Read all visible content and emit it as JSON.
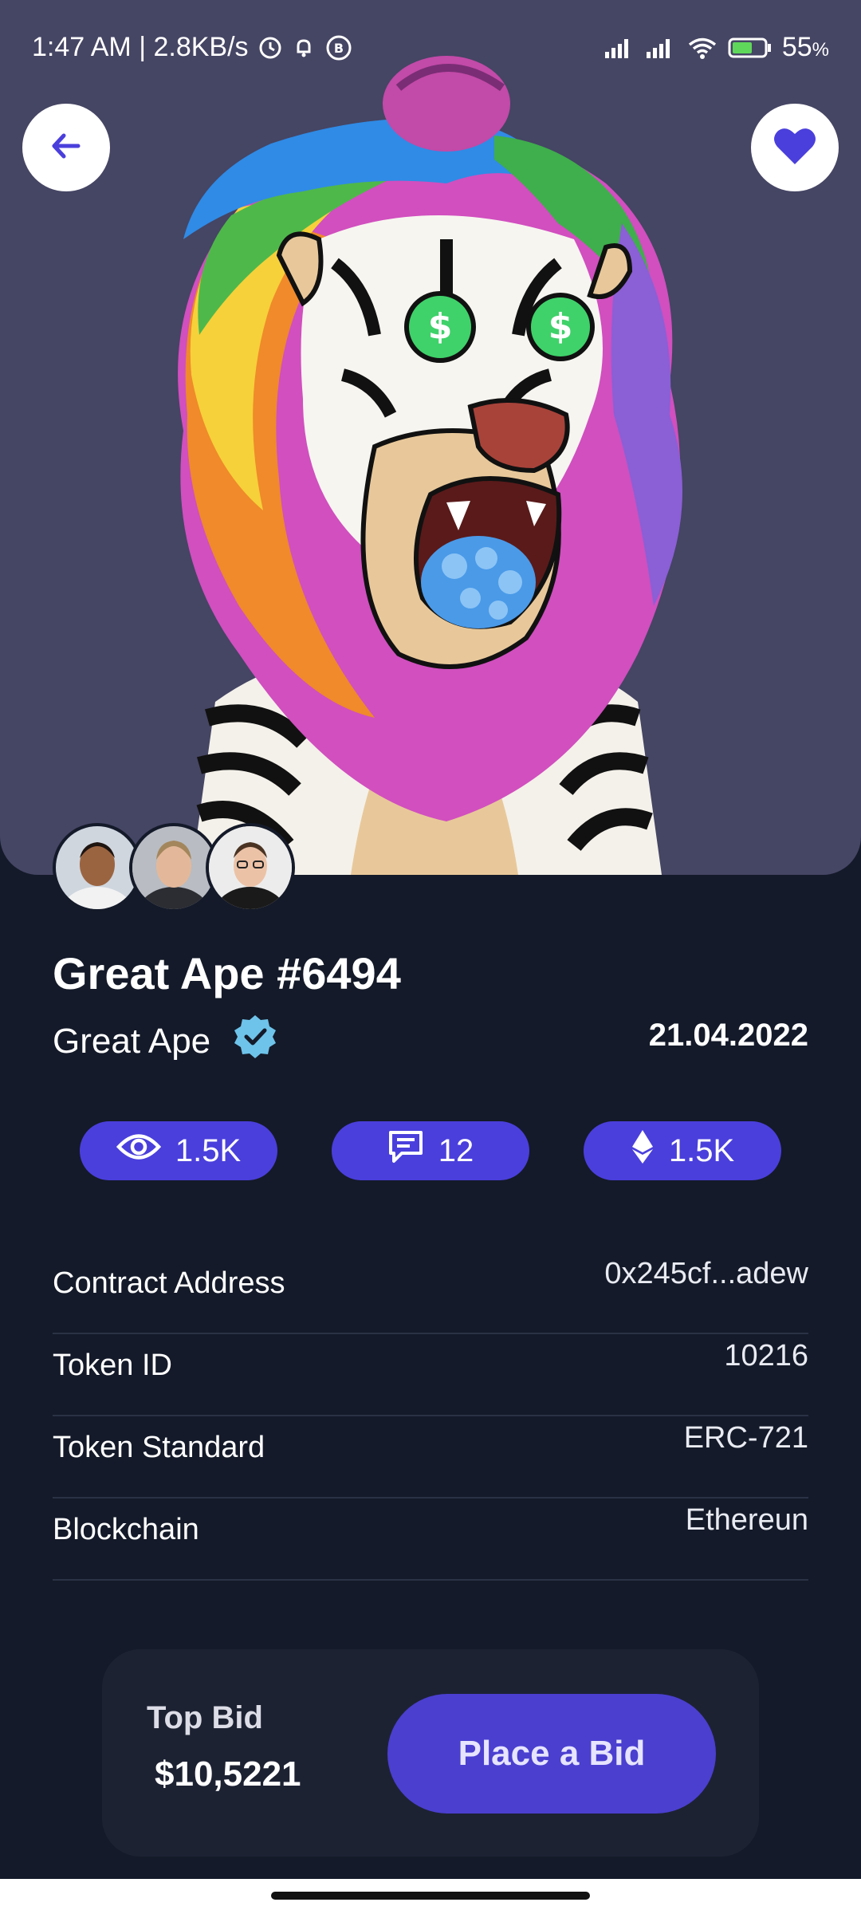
{
  "status_bar": {
    "time_speed": "1:47 AM | 2.8KB/s",
    "battery": "55",
    "battery_unit": "%",
    "icons": [
      "alarm-icon",
      "notification-icon",
      "b-badge-icon",
      "signal-icon",
      "signal-icon-2",
      "wifi-icon",
      "battery-icon"
    ]
  },
  "header": {
    "back_icon": "arrow-left-icon",
    "favorite_icon": "heart-icon"
  },
  "nft": {
    "title": "Great Ape #6494",
    "collection": "Great Ape",
    "verified_icon": "verified-badge-icon",
    "date": "21.04.2022",
    "owners": [
      "avatar-1",
      "avatar-2",
      "avatar-3"
    ]
  },
  "stats": [
    {
      "icon": "eye-icon",
      "value": "1.5K"
    },
    {
      "icon": "comment-icon",
      "value": "12"
    },
    {
      "icon": "ethereum-icon",
      "value": "1.5K"
    }
  ],
  "details": [
    {
      "label": "Contract Address",
      "value": "0x245cf...adew"
    },
    {
      "label": "Token ID",
      "value": "10216"
    },
    {
      "label": "Token Standard",
      "value": "ERC-721"
    },
    {
      "label": "Blockchain",
      "value": "Ethereun"
    }
  ],
  "bid": {
    "label": "Top Bid",
    "value": "$10,5221",
    "button_label": "Place a Bid"
  },
  "colors": {
    "background": "#141a29",
    "accent": "#4a3fdc",
    "hero_bg": "#454564"
  }
}
